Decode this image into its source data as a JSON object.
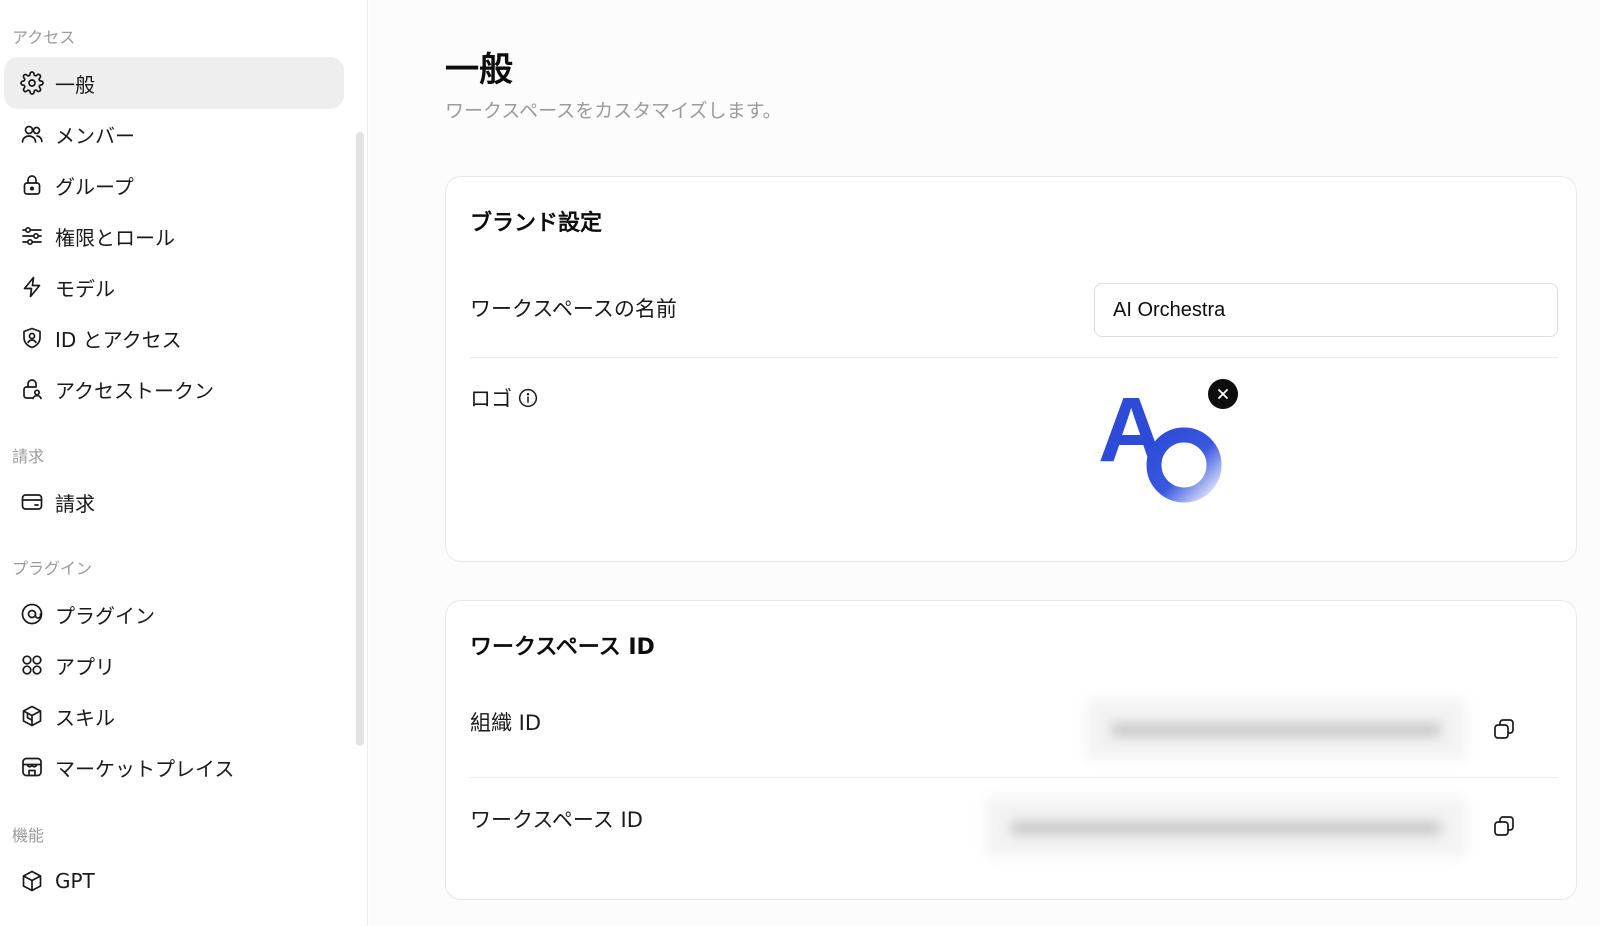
{
  "sidebar": {
    "sections": {
      "access": "アクセス",
      "billing": "請求",
      "plugins": "プラグイン",
      "features": "機能"
    },
    "items": {
      "general": "一般",
      "members": "メンバー",
      "groups": "グループ",
      "roles": "権限とロール",
      "models": "モデル",
      "identity": "ID とアクセス",
      "tokens": "アクセストークン",
      "billing": "請求",
      "plugins": "プラグイン",
      "apps": "アプリ",
      "skills": "スキル",
      "marketplace": "マーケットプレイス",
      "gpt": "GPT"
    },
    "icons": {
      "general": "gear-icon",
      "members": "users-icon",
      "groups": "lock-icon",
      "roles": "sliders-icon",
      "models": "bolt-icon",
      "identity": "shield-user-icon",
      "tokens": "lock-user-icon",
      "billing": "card-icon",
      "plugins": "at-icon",
      "apps": "grid-icon",
      "skills": "cube-icon",
      "marketplace": "store-icon",
      "gpt": "box-icon"
    }
  },
  "page": {
    "title": "一般",
    "subtitle": "ワークスペースをカスタマイズします。"
  },
  "brand": {
    "title": "ブランド設定",
    "name_label": "ワークスペースの名前",
    "name_value": "AI Orchestra",
    "logo_label": "ロゴ",
    "logo_text_a": "A",
    "accent_color": "#2d4bd6"
  },
  "workspace_ids": {
    "title": "ワークスペース ID",
    "org_label": "組織 ID",
    "workspace_label": "ワークスペース ID"
  }
}
